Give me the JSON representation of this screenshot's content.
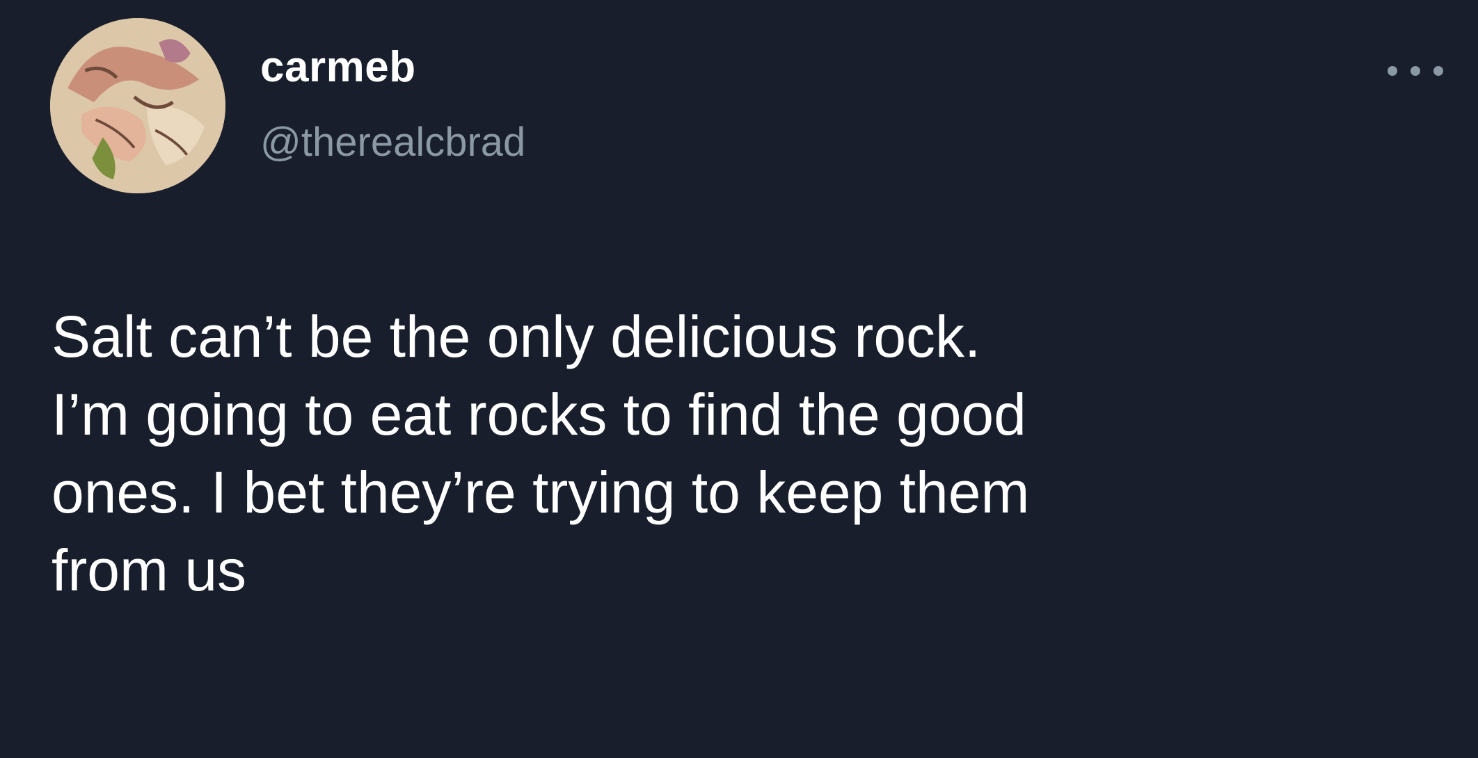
{
  "tweet": {
    "author": {
      "display_name": "carmeb",
      "handle": "@therealcbrad",
      "avatar_icon": "avatar-illustration"
    },
    "more_icon": "more-options-icon",
    "text_lines": [
      "Salt can’t be the only delicious rock.",
      "I’m going to eat rocks to find the good",
      "ones. I bet they’re trying to keep them",
      "from us"
    ]
  },
  "colors": {
    "background": "#181e2b",
    "primary_text": "#ffffff",
    "secondary_text": "#8b98a5"
  }
}
